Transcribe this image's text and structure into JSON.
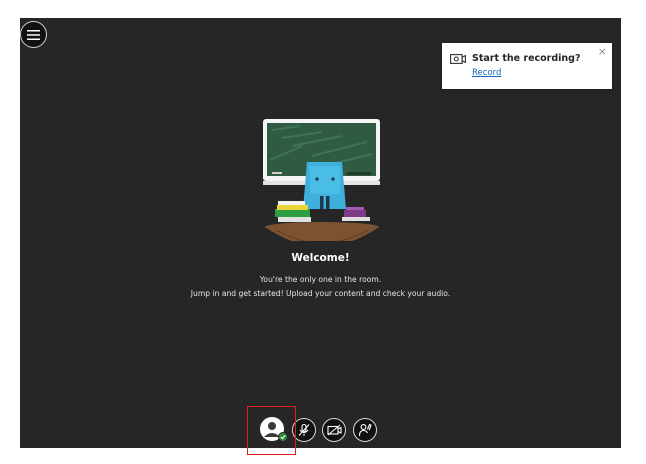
{
  "recording_toast": {
    "title": "Start the recording?",
    "link": "Record",
    "close_glyph": "×",
    "icon": "video-camera-icon"
  },
  "welcome": {
    "heading": "Welcome!",
    "line1": "You're the only one in the room.",
    "line2": "Jump in and get started! Upload your content and check your audio."
  },
  "controls": {
    "avatar": "user-avatar-icon",
    "status": "checkmark-icon",
    "microphone": "microphone-muted-icon",
    "camera": "camera-off-icon",
    "hand": "raise-hand-icon"
  },
  "menu": {
    "icon": "hamburger-menu-icon"
  },
  "colors": {
    "background": "#262626",
    "link": "#1565c0",
    "status_green": "#2a8c3c",
    "highlight": "#e02020"
  }
}
